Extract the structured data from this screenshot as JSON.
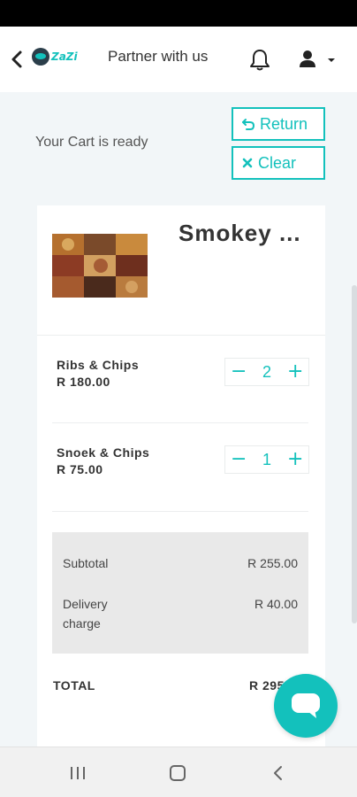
{
  "nav": {
    "logo_text": "ZaZi",
    "partner_link": "Partner with us",
    "icons": [
      "back-arrow-icon",
      "bell-icon",
      "user-icon",
      "caret-down-icon"
    ]
  },
  "cart": {
    "status_text": "Your Cart is ready",
    "return_label": "Return",
    "clear_label": "Clear",
    "restaurant_name": "Smokey ...",
    "items": [
      {
        "name": "Ribs & Chips",
        "price": "R 180.00",
        "quantity": "2"
      },
      {
        "name": "Snoek & Chips",
        "price": "R 75.00",
        "quantity": "1"
      }
    ],
    "subtotal_label": "Subtotal",
    "subtotal_value": "R 255.00",
    "delivery_label_line1": "Delivery",
    "delivery_label_line2": "charge",
    "delivery_value": "R 40.00",
    "total_label": "TOTAL",
    "total_value": "R 295.00"
  },
  "colors": {
    "accent": "#13c1bc",
    "background": "#f2f6f8",
    "summary_bg": "#e9e9e9"
  },
  "android_nav": {
    "icons": [
      "recent-apps-icon",
      "home-icon",
      "back-icon"
    ]
  }
}
